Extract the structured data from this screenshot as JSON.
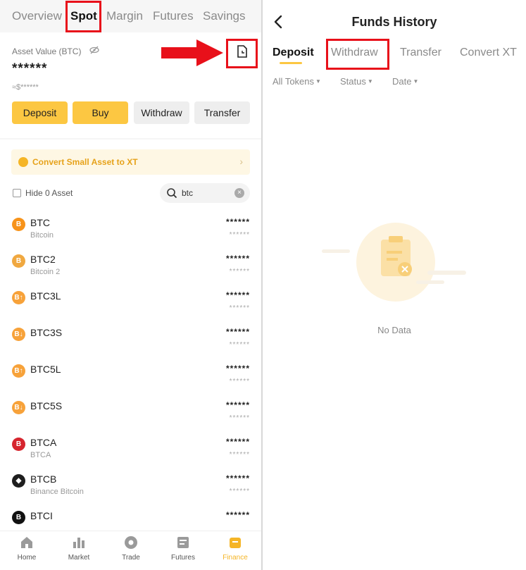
{
  "left": {
    "top_tabs": [
      {
        "label": "Overview",
        "active": false
      },
      {
        "label": "Spot",
        "active": true
      },
      {
        "label": "Margin",
        "active": false
      },
      {
        "label": "Futures",
        "active": false
      },
      {
        "label": "Savings",
        "active": false
      }
    ],
    "asset": {
      "label": "Asset Value (BTC)",
      "value": "******",
      "usd": "≈$******"
    },
    "actions": [
      {
        "label": "Deposit",
        "style": "yellow"
      },
      {
        "label": "Buy",
        "style": "yellow"
      },
      {
        "label": "Withdraw",
        "style": "gray"
      },
      {
        "label": "Transfer",
        "style": "gray"
      }
    ],
    "convert_banner": "Convert Small Asset to XT",
    "hide_zero_label": "Hide 0 Asset",
    "search": {
      "value": "btc",
      "placeholder": ""
    },
    "coins": [
      {
        "symbol": "BTC",
        "name": "Bitcoin",
        "amount": "******",
        "sub": "******",
        "icon_color": "#f7931a",
        "icon_glyph": "B"
      },
      {
        "symbol": "BTC2",
        "name": "Bitcoin 2",
        "amount": "******",
        "sub": "******",
        "icon_color": "#f0a840",
        "icon_glyph": "B"
      },
      {
        "symbol": "BTC3L",
        "name": "",
        "amount": "******",
        "sub": "******",
        "icon_color": "#f7a23a",
        "icon_glyph": "B↑"
      },
      {
        "symbol": "BTC3S",
        "name": "",
        "amount": "******",
        "sub": "******",
        "icon_color": "#f7a23a",
        "icon_glyph": "B↓"
      },
      {
        "symbol": "BTC5L",
        "name": "",
        "amount": "******",
        "sub": "******",
        "icon_color": "#f7a23a",
        "icon_glyph": "B↑"
      },
      {
        "symbol": "BTC5S",
        "name": "",
        "amount": "******",
        "sub": "******",
        "icon_color": "#f7a23a",
        "icon_glyph": "B↓"
      },
      {
        "symbol": "BTCA",
        "name": "BTCA",
        "amount": "******",
        "sub": "******",
        "icon_color": "#d6252e",
        "icon_glyph": "B"
      },
      {
        "symbol": "BTCB",
        "name": "Binance Bitcoin",
        "amount": "******",
        "sub": "******",
        "icon_color": "#1e1e1e",
        "icon_glyph": "◆"
      },
      {
        "symbol": "BTCI",
        "name": "",
        "amount": "******",
        "sub": "",
        "icon_color": "#111111",
        "icon_glyph": "B"
      }
    ],
    "bottom_nav": [
      {
        "label": "Home",
        "icon": "home-icon",
        "active": false
      },
      {
        "label": "Market",
        "icon": "market-icon",
        "active": false
      },
      {
        "label": "Trade",
        "icon": "trade-icon",
        "active": false
      },
      {
        "label": "Futures",
        "icon": "futures-icon",
        "active": false
      },
      {
        "label": "Finance",
        "icon": "finance-icon",
        "active": true
      }
    ]
  },
  "right": {
    "title": "Funds History",
    "tabs": [
      {
        "label": "Deposit",
        "active": true
      },
      {
        "label": "Withdraw",
        "active": false
      },
      {
        "label": "Transfer",
        "active": false
      },
      {
        "label": "Convert XT",
        "active": false
      }
    ],
    "filters": [
      "All Tokens",
      "Status",
      "Date"
    ],
    "empty_text": "No Data"
  },
  "colors": {
    "accent": "#fcc742",
    "highlight": "#e8101a"
  }
}
